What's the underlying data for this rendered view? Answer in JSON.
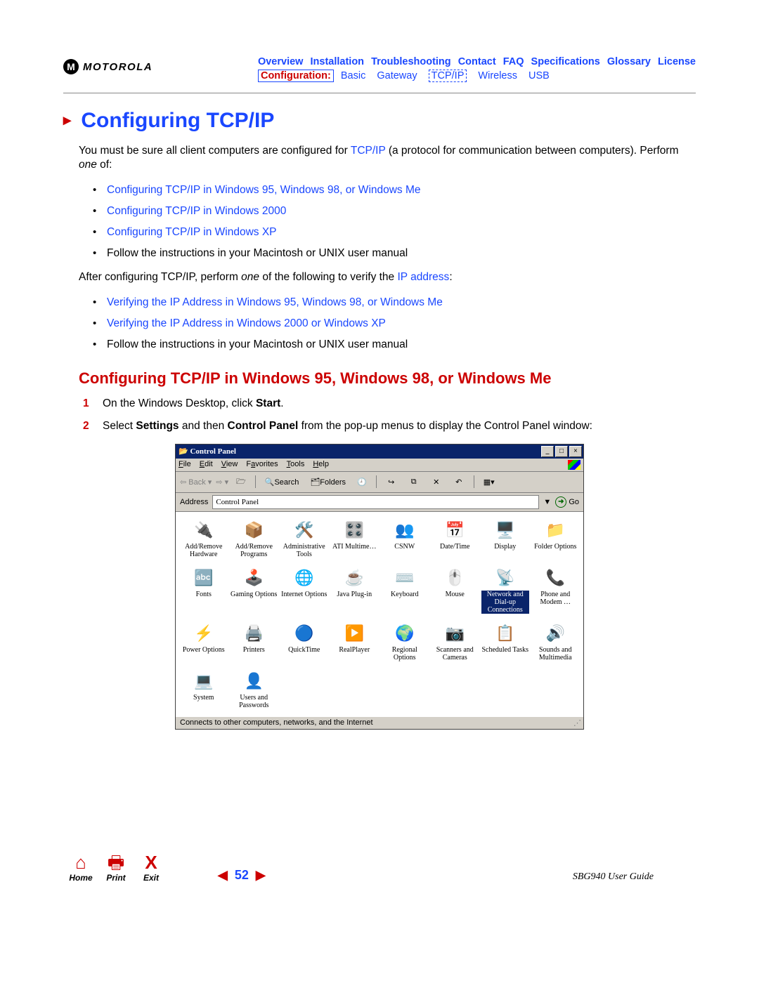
{
  "brand": {
    "glyph": "M",
    "word": "MOTOROLA"
  },
  "nav": {
    "top": [
      "Overview",
      "Installation",
      "Troubleshooting",
      "Contact",
      "FAQ",
      "Specifications",
      "Glossary",
      "License"
    ],
    "sub": {
      "current": "Configuration:",
      "items": [
        "Basic",
        "Gateway",
        "TCP/IP",
        "Wireless",
        "USB"
      ],
      "dashed": "TCP/IP"
    }
  },
  "h1": "Configuring TCP/IP",
  "intro": {
    "pre": "You must be sure all client computers are configured for ",
    "link": "TCP/IP",
    "post": " (a protocol for communication between computers). Perform ",
    "em": "one",
    "post2": " of:"
  },
  "bullets1": [
    {
      "text": "Configuring TCP/IP in Windows 95, Windows 98, or Windows Me",
      "link": true
    },
    {
      "text": "Configuring TCP/IP in Windows 2000",
      "link": true
    },
    {
      "text": "Configuring TCP/IP in Windows XP",
      "link": true
    },
    {
      "text": "Follow the instructions in your Macintosh or UNIX user manual",
      "link": false
    }
  ],
  "mid": {
    "pre": "After configuring TCP/IP, perform ",
    "em": "one",
    "post": " of the following to verify the ",
    "link": "IP address",
    "post2": ":"
  },
  "bullets2": [
    {
      "text": "Verifying the IP Address in Windows 95, Windows 98, or Windows Me",
      "link": true
    },
    {
      "text": "Verifying the IP Address in Windows 2000 or Windows XP",
      "link": true
    },
    {
      "text": "Follow the instructions in your Macintosh or UNIX user manual",
      "link": false
    }
  ],
  "h2": "Configuring TCP/IP in Windows 95, Windows 98, or Windows Me",
  "steps": [
    {
      "pre": "On the Windows Desktop, click ",
      "b": "Start",
      "post": "."
    },
    {
      "pre": "Select ",
      "b": "Settings",
      "mid": " and then ",
      "b2": "Control Panel",
      "post": " from the pop-up menus to display the Control Panel window:"
    }
  ],
  "cp": {
    "title": "Control Panel",
    "menu": [
      "File",
      "Edit",
      "View",
      "Favorites",
      "Tools",
      "Help"
    ],
    "toolbar": {
      "back": "Back",
      "search": "Search",
      "folders": "Folders"
    },
    "addr_label": "Address",
    "addr_value": "Control Panel",
    "go": "Go",
    "icons": [
      {
        "g": "🔌",
        "t": "Add/Remove Hardware"
      },
      {
        "g": "📦",
        "t": "Add/Remove Programs"
      },
      {
        "g": "🛠️",
        "t": "Administrative Tools"
      },
      {
        "g": "🎛️",
        "t": "ATI Multime…"
      },
      {
        "g": "👥",
        "t": "CSNW"
      },
      {
        "g": "📅",
        "t": "Date/Time"
      },
      {
        "g": "🖥️",
        "t": "Display"
      },
      {
        "g": "📁",
        "t": "Folder Options"
      },
      {
        "g": "🔤",
        "t": "Fonts"
      },
      {
        "g": "🕹️",
        "t": "Gaming Options"
      },
      {
        "g": "🌐",
        "t": "Internet Options"
      },
      {
        "g": "☕",
        "t": "Java Plug-in"
      },
      {
        "g": "⌨️",
        "t": "Keyboard"
      },
      {
        "g": "🖱️",
        "t": "Mouse"
      },
      {
        "g": "📡",
        "t": "Network and Dial-up Connections",
        "sel": true
      },
      {
        "g": "📞",
        "t": "Phone and Modem …"
      },
      {
        "g": "⚡",
        "t": "Power Options"
      },
      {
        "g": "🖨️",
        "t": "Printers"
      },
      {
        "g": "🔵",
        "t": "QuickTime"
      },
      {
        "g": "▶️",
        "t": "RealPlayer"
      },
      {
        "g": "🌍",
        "t": "Regional Options"
      },
      {
        "g": "📷",
        "t": "Scanners and Cameras"
      },
      {
        "g": "📋",
        "t": "Scheduled Tasks"
      },
      {
        "g": "🔊",
        "t": "Sounds and Multimedia"
      },
      {
        "g": "💻",
        "t": "System"
      },
      {
        "g": "👤",
        "t": "Users and Passwords"
      }
    ],
    "status": "Connects to other computers, networks, and the Internet"
  },
  "footer": {
    "home": "Home",
    "print": "Print",
    "exit": "Exit",
    "exit_glyph": "X",
    "page": "52",
    "guide": "SBG940 User Guide"
  }
}
